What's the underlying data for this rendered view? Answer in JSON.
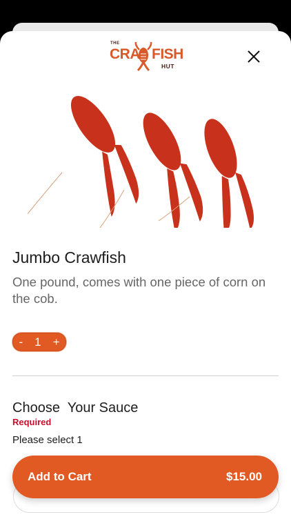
{
  "logo": {
    "the": "THE",
    "cra": "CRA",
    "fish": "FISH",
    "hut": "HUT"
  },
  "product": {
    "name": "Jumbo Crawfish",
    "description": "One pound, comes with one piece of corn on the cob."
  },
  "quantity": {
    "minus": "-",
    "value": "1",
    "plus": "+"
  },
  "sauce": {
    "title": "Choose  Your Sauce",
    "required": "Required",
    "instruction": "Please select 1"
  },
  "cart": {
    "label": "Add to Cart",
    "price": "$15.00"
  },
  "colors": {
    "accent": "#e25a23",
    "required": "#c8102e"
  },
  "icons": {
    "close": "close-icon",
    "logo": "crawfish-logo-icon",
    "hero": "crawfish-image"
  }
}
